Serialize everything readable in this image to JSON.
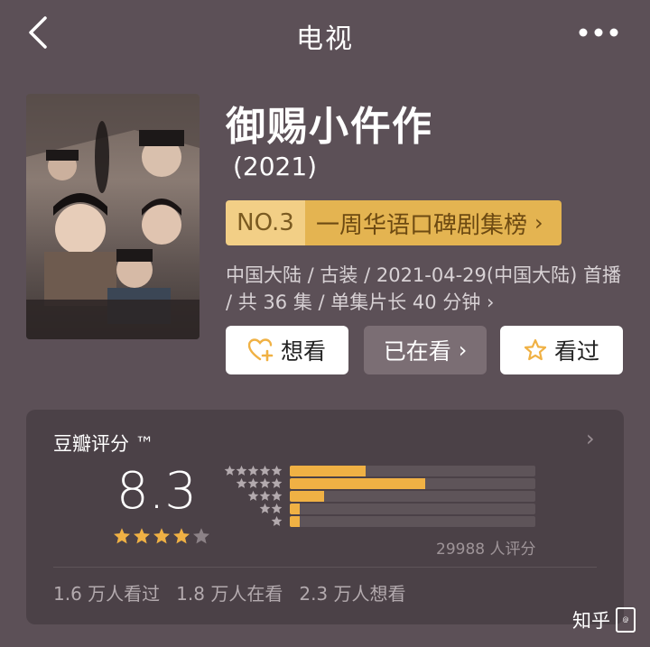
{
  "header": {
    "title": "电视",
    "back_icon": "back-chevron-icon",
    "more_icon": "more-dots-icon"
  },
  "drama": {
    "title": "御赐小仵作",
    "year": "(2021)",
    "rank_no": "NO.3",
    "rank_text": "一周华语口碑剧集榜",
    "meta": "中国大陆 / 古装 / 2021-04-29(中国大陆) 首播 / 共 36 集 / 单集片长 40 分钟"
  },
  "actions": {
    "want": "想看",
    "watching": "已在看",
    "watched": "看过"
  },
  "rating": {
    "title": "豆瓣评分 ™",
    "score": "8.3",
    "stars_filled": 4,
    "stars_total": 5,
    "distribution": [
      {
        "stars": 5,
        "fraction": 0.31
      },
      {
        "stars": 4,
        "fraction": 0.55
      },
      {
        "stars": 3,
        "fraction": 0.14
      },
      {
        "stars": 2,
        "fraction": 0.04
      },
      {
        "stars": 1,
        "fraction": 0.04
      }
    ],
    "count_text": "29988 人评分",
    "seen": "1.6 万人看过",
    "watching": "1.8 万人在看",
    "wanting": "2.3 万人想看"
  },
  "watermark": {
    "text": "知乎",
    "badge": "@"
  },
  "colors": {
    "accent": "#f0b144",
    "rank_bg": "#e4b451",
    "background": "#5c5057",
    "card": "#4b4147"
  }
}
